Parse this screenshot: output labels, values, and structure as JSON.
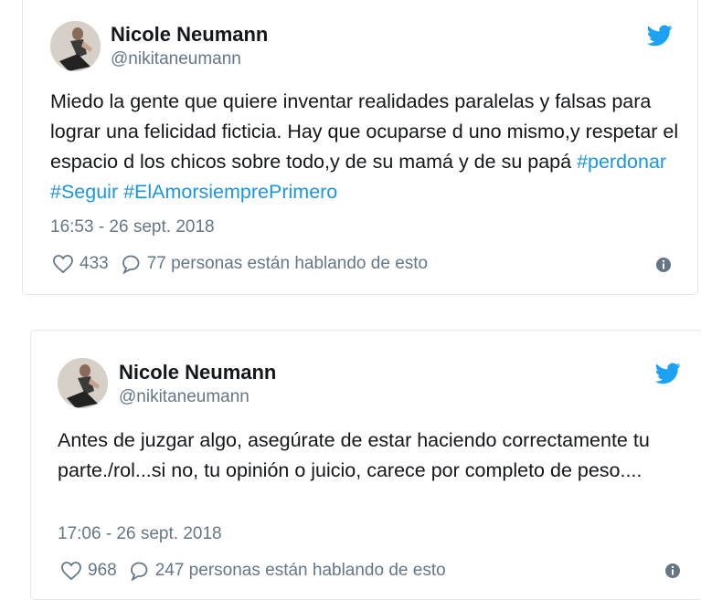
{
  "tweets": [
    {
      "name": "Nicole Neumann",
      "handle": "@nikitaneumann",
      "text": "Miedo la gente que quiere inventar realidades paralelas y falsas para lograr una felicidad ficticia. Hay que ocuparse d uno mismo,y respetar el espacio d los chicos sobre todo,y de su mamá y de su papá",
      "hashtags": [
        "#perdonar",
        "#Seguir",
        "#ElAmorsiemprePrimero"
      ],
      "timestamp": "16:53 - 26 sept. 2018",
      "likes": "433",
      "conversation": "77 personas están hablando de esto"
    },
    {
      "name": "Nicole Neumann",
      "handle": "@nikitaneumann",
      "text": "Antes de juzgar algo, asegúrate de estar haciendo correctamente tu parte./rol...si no, tu opinión o juicio, carece por completo de peso....",
      "timestamp": "17:06 - 26 sept. 2018",
      "likes": "968",
      "conversation": "247 personas están hablando de esto"
    }
  ],
  "colors": {
    "twitter_blue": "#1da1f2",
    "hashtag": "#1b95e0",
    "muted": "#657786",
    "border": "#e1e8ed"
  },
  "icons": [
    "twitter-bird-icon",
    "heart-icon",
    "speech-bubble-icon",
    "info-icon"
  ]
}
